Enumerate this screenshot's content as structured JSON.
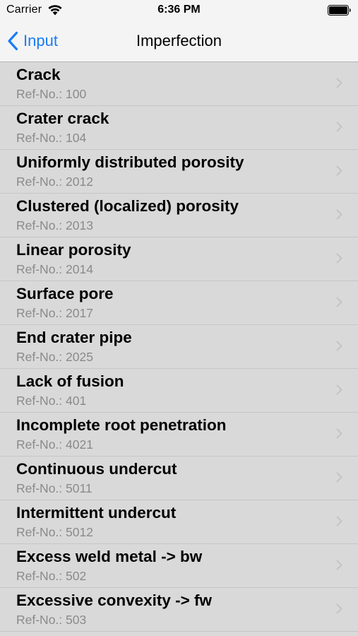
{
  "status_bar": {
    "carrier": "Carrier",
    "time": "6:36 PM"
  },
  "nav": {
    "back_label": "Input",
    "title": "Imperfection"
  },
  "colors": {
    "accent": "#1a7cf5",
    "row_background": "#d9d9d9",
    "subtitle": "#8a8a8a"
  },
  "items": [
    {
      "title": "Crack",
      "ref": "Ref-No.: 100"
    },
    {
      "title": "Crater crack",
      "ref": "Ref-No.: 104"
    },
    {
      "title": "Uniformly distributed porosity",
      "ref": "Ref-No.: 2012"
    },
    {
      "title": "Clustered (localized) porosity",
      "ref": "Ref-No.: 2013"
    },
    {
      "title": "Linear porosity",
      "ref": "Ref-No.: 2014"
    },
    {
      "title": "Surface pore",
      "ref": "Ref-No.: 2017"
    },
    {
      "title": "End crater pipe",
      "ref": "Ref-No.: 2025"
    },
    {
      "title": "Lack of fusion",
      "ref": "Ref-No.: 401"
    },
    {
      "title": "Incomplete root penetration",
      "ref": "Ref-No.: 4021"
    },
    {
      "title": "Continuous undercut",
      "ref": "Ref-No.: 5011"
    },
    {
      "title": "Intermittent undercut",
      "ref": "Ref-No.: 5012"
    },
    {
      "title": "Excess weld metal -> bw",
      "ref": "Ref-No.: 502"
    },
    {
      "title": "Excessive convexity -> fw",
      "ref": "Ref-No.: 503"
    }
  ]
}
